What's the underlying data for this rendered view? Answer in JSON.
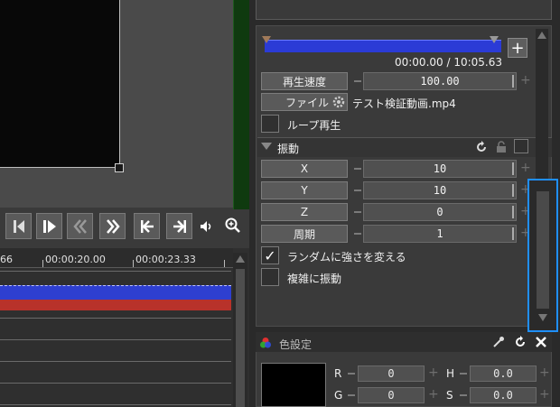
{
  "transport": {
    "buttons": [
      "prev-frame",
      "play",
      "rewind",
      "fast-forward",
      "jump-start",
      "jump-end"
    ],
    "icons": [
      "volume-icon",
      "zoom-icon"
    ]
  },
  "timeline": {
    "ruler_labels": [
      "66",
      "00:00:20.00",
      "00:00:23.33"
    ],
    "audio_colors": {
      "top": "#2e3fd0",
      "bottom": "#b8322a"
    }
  },
  "media": {
    "time_readout": "00:00.00 / 10:05.63",
    "speed_label": "再生速度",
    "speed_value": "100.00",
    "file_label": "ファイル",
    "file_name": "テスト検証動画.mp4",
    "loop_label": "ループ再生",
    "loop_checked": false
  },
  "vibration": {
    "title": "振動",
    "params": [
      {
        "label": "X",
        "value": "10"
      },
      {
        "label": "Y",
        "value": "10"
      },
      {
        "label": "Z",
        "value": "0"
      },
      {
        "label": "周期",
        "value": "1"
      }
    ],
    "random_label": "ランダムに強さを変える",
    "random_checked": true,
    "complex_label": "複雑に振動",
    "complex_checked": false
  },
  "color": {
    "title": "色設定",
    "rows": [
      {
        "left_label": "R",
        "left_value": "0",
        "right_label": "H",
        "right_value": "0.0"
      },
      {
        "left_label": "G",
        "left_value": "0",
        "right_label": "S",
        "right_value": "0.0"
      }
    ],
    "swatch_color": "#000000"
  },
  "accent": "#1f8fff"
}
